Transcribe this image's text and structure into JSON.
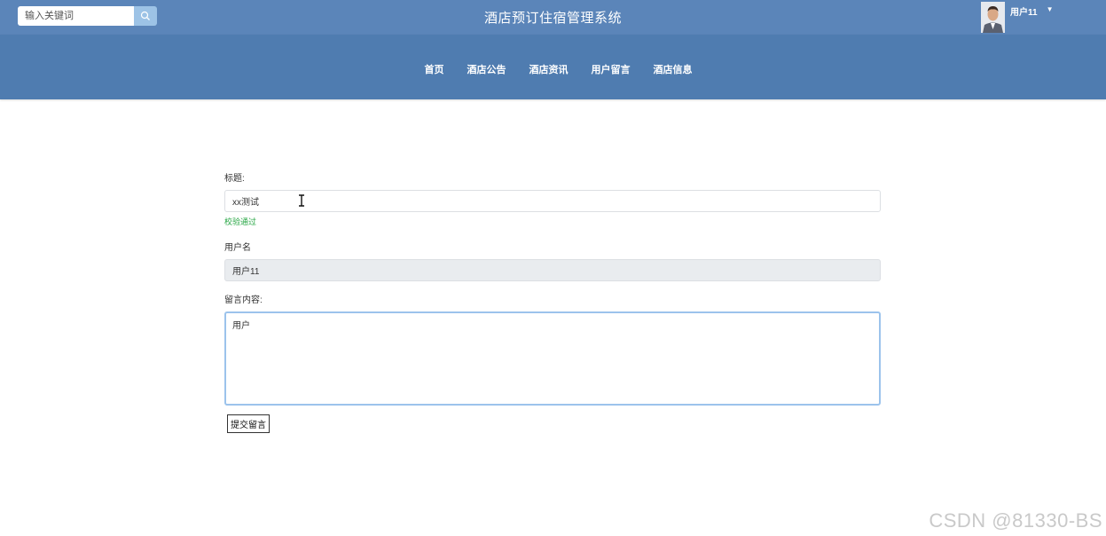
{
  "header": {
    "search_placeholder": "输入关键词",
    "site_title": "酒店预订住宿管理系统",
    "user_name": "用户11",
    "icons": {
      "search": "search-icon",
      "caret": "caret-down-icon",
      "avatar": "user-avatar"
    }
  },
  "nav": {
    "items": [
      {
        "label": "首页"
      },
      {
        "label": "酒店公告"
      },
      {
        "label": "酒店资讯"
      },
      {
        "label": "用户留言"
      },
      {
        "label": "酒店信息"
      }
    ]
  },
  "form": {
    "title_label": "标题:",
    "title_value": "xx测试",
    "title_validation": "校验通过",
    "username_label": "用户名",
    "username_value": "用户11",
    "content_label": "留言内容:",
    "content_value": "用户",
    "submit_label": "提交留言"
  },
  "watermark": "CSDN @81330-BS",
  "colors": {
    "topbar": "#5b85b9",
    "navbar": "#4f7cb0",
    "search_button": "#9dc3e6",
    "valid_text": "#28a745",
    "focus_border": "#9cc3ec"
  }
}
